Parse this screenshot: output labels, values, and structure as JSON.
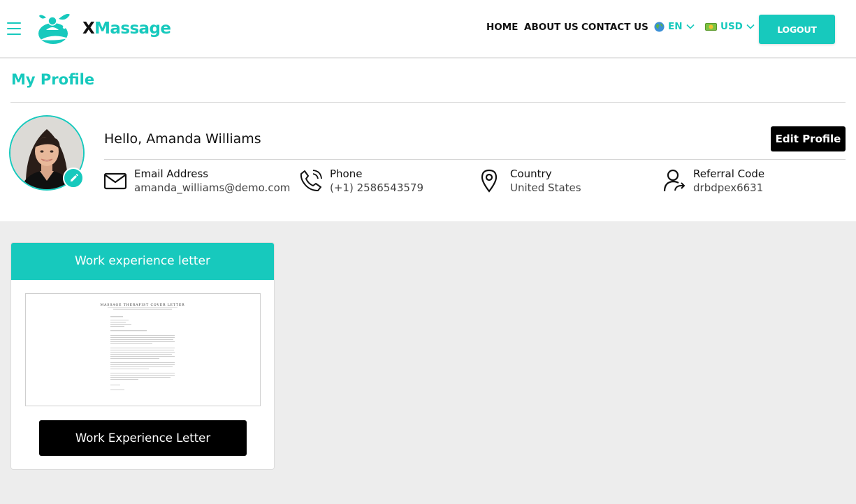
{
  "header": {
    "brand_x": "X",
    "brand_rest": "Massage",
    "nav": {
      "home": "HOME",
      "about": "ABOUT US",
      "contact": "CONTACT US"
    },
    "language": "EN",
    "currency": "USD",
    "logout_label": "LOGOUT"
  },
  "profile": {
    "title": "My Profile",
    "greeting": "Hello, Amanda Williams",
    "edit_label": "Edit Profile",
    "email": {
      "label": "Email Address",
      "value": "amanda_williams@demo.com"
    },
    "phone": {
      "label": "Phone",
      "value": "(+1) 2586543579"
    },
    "country": {
      "label": "Country",
      "value": "United States"
    },
    "referral": {
      "label": "Referral Code",
      "value": "drbdpex6631"
    }
  },
  "documents": {
    "card_title": "Work experience letter",
    "document_heading": "MASSAGE THERAPIST COVER LETTER",
    "button_label": "Work Experience Letter"
  },
  "colors": {
    "accent": "#17c9bd",
    "dark": "#000000",
    "page_bg": "#ededed"
  }
}
